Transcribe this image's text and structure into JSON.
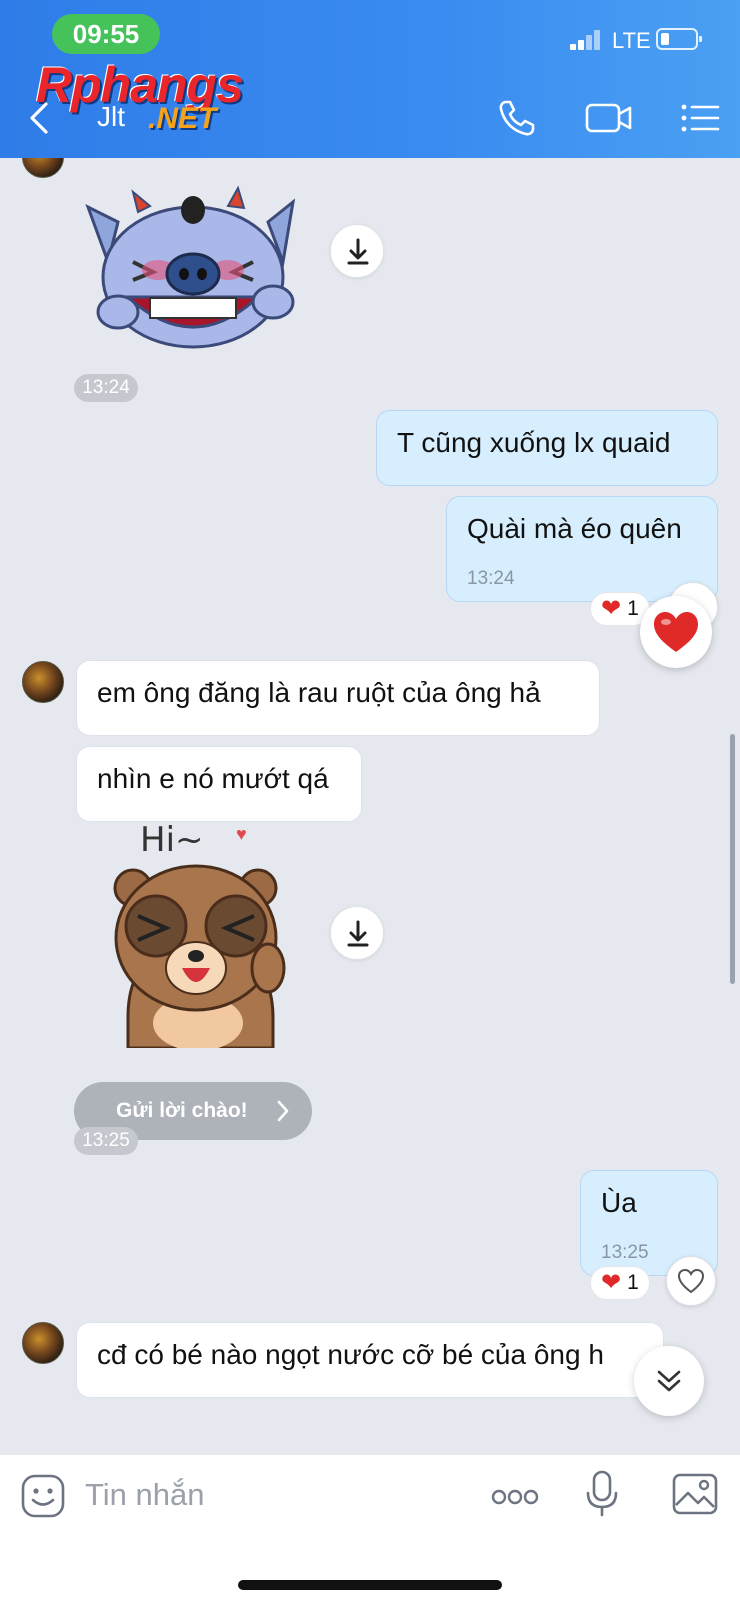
{
  "status_bar": {
    "time": "09:55",
    "network": "LTE",
    "battery_level": 0.15
  },
  "watermark": {
    "line1": "Rphangs",
    "line2": ".NET"
  },
  "header": {
    "title": "Jlt"
  },
  "messages": {
    "t1": "13:24",
    "out1": "T cũng xuống lx quaid",
    "out2": "Quài mà éo quên",
    "out2_time": "13:24",
    "out2_reaction_count": "1",
    "in1": "em ông đăng là rau ruột của ông hả",
    "in2": "nhìn e nó mướt qá",
    "sticker2_caption": "Hi~",
    "greet_button": "Gửi lời chào!",
    "t2": "13:25",
    "out3": "Ùa",
    "out3_time": "13:25",
    "out3_reaction_count": "1",
    "in3": "cđ có bé nào ngọt nước cỡ bé của ông h"
  },
  "composer": {
    "placeholder": "Tin nhắn"
  },
  "icons": {
    "back": "chevron-left-icon",
    "phone": "phone-icon",
    "video": "video-camera-icon",
    "menu": "list-menu-icon",
    "download": "download-icon",
    "emoji": "emoji-icon",
    "more": "more-icon",
    "mic": "microphone-icon",
    "image": "image-icon",
    "scroll_down": "double-chevron-down-icon",
    "heart": "heart-icon"
  },
  "colors": {
    "header_blue": "#2f7ce8",
    "outgoing_bubble": "#d6eefd",
    "incoming_bubble": "#ffffff",
    "heart_red": "#e02a2a",
    "time_pill_green": "#46c25a"
  }
}
